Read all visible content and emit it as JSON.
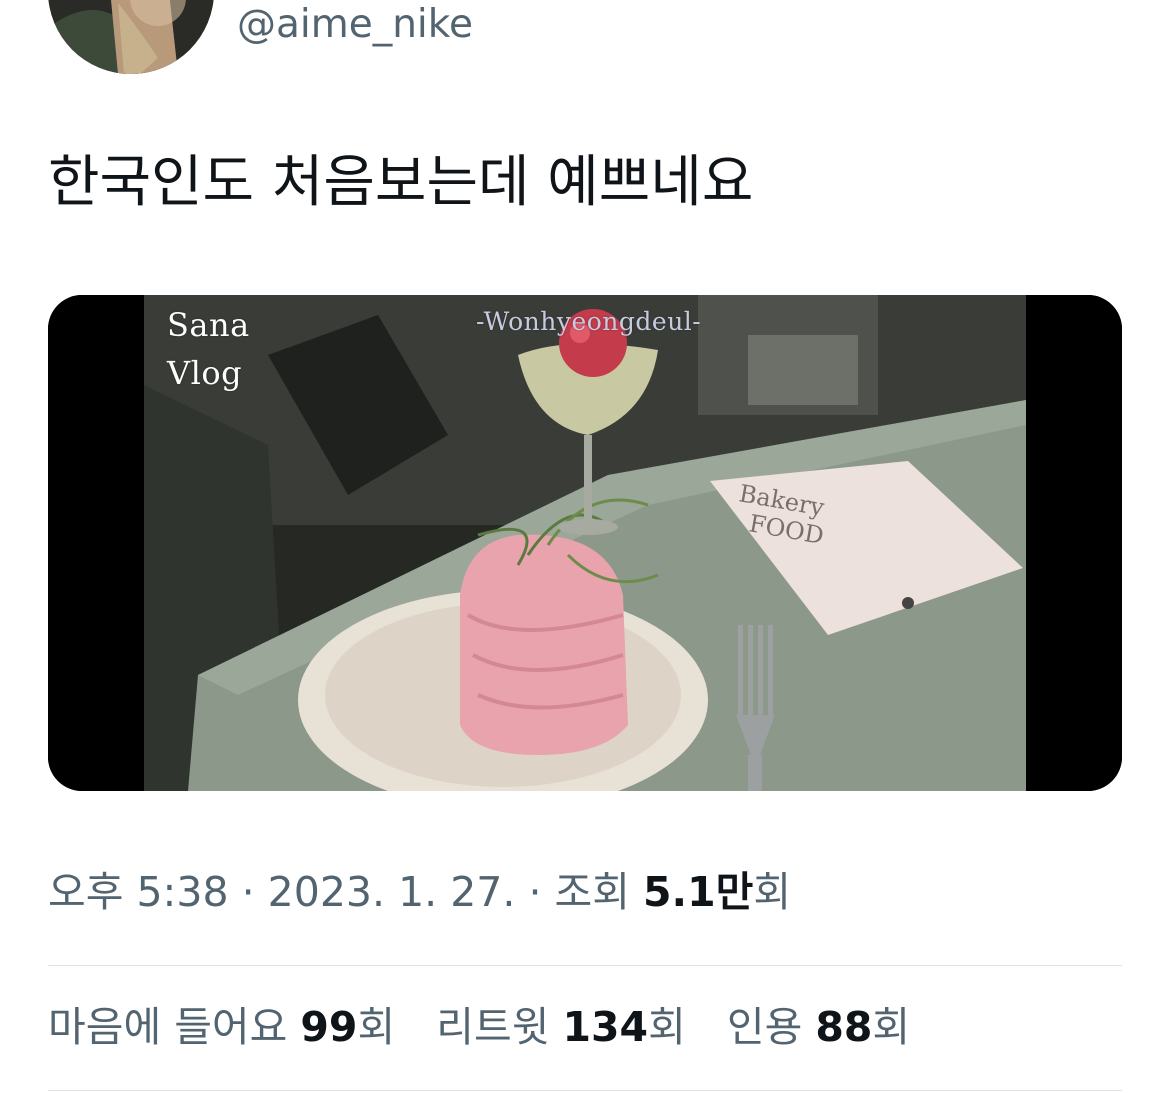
{
  "author": {
    "handle": "@aime_nike"
  },
  "tweet": {
    "text": "한국인도 처음보는데 예쁘네요"
  },
  "media": {
    "overlay_line1": "Sana",
    "overlay_line2": "Vlog",
    "watermark": "-Wonhyeongdeul-"
  },
  "meta": {
    "time": "오후 5:38",
    "separator": " · ",
    "date": "2023. 1. 27.",
    "views_label": "조회",
    "views_count": "5.1만",
    "views_suffix": "회"
  },
  "stats": {
    "likes_label": "마음에 들어요",
    "likes_count": "99",
    "retweets_label": "리트윗",
    "retweets_count": "134",
    "quotes_label": "인용",
    "quotes_count": "88",
    "suffix": "회"
  },
  "colors": {
    "text_primary": "#0f1419",
    "text_secondary": "#536471",
    "divider": "#dfe3e8"
  }
}
